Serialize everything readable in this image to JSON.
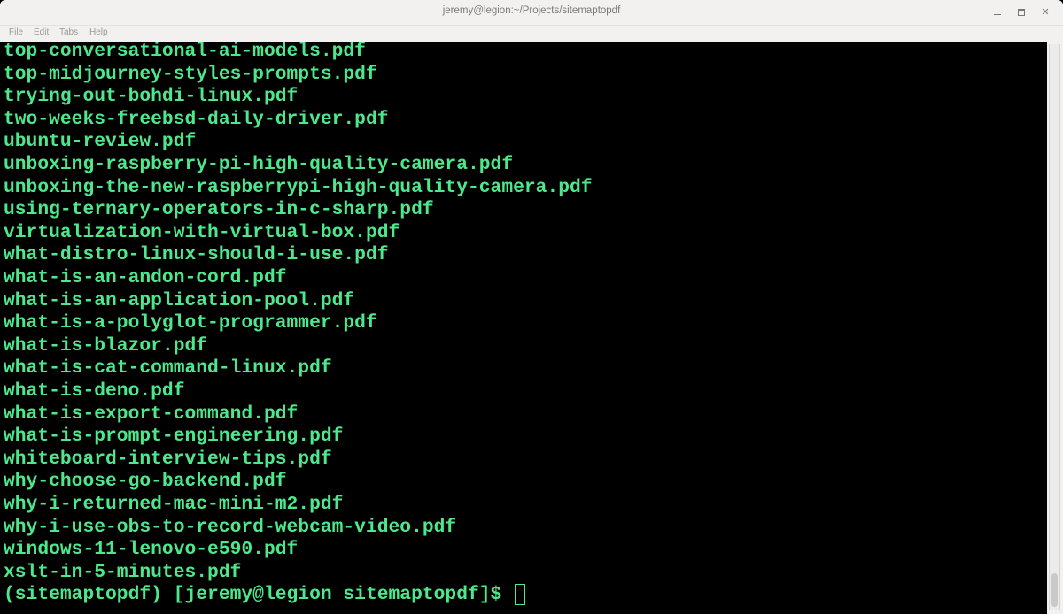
{
  "window": {
    "title": "jeremy@legion:~/Projects/sitemaptopdf",
    "controls": {
      "minimize": "minimize-icon",
      "maximize": "maximize-icon",
      "close": "close-icon",
      "close_glyph": "✕"
    }
  },
  "menubar": {
    "items": [
      "File",
      "Edit",
      "Tabs",
      "Help"
    ]
  },
  "terminal": {
    "text_color": "#4ee88c",
    "background": "#000000",
    "lines": [
      "top-conversational-ai-models.pdf",
      "top-midjourney-styles-prompts.pdf",
      "trying-out-bohdi-linux.pdf",
      "two-weeks-freebsd-daily-driver.pdf",
      "ubuntu-review.pdf",
      "unboxing-raspberry-pi-high-quality-camera.pdf",
      "unboxing-the-new-raspberrypi-high-quality-camera.pdf",
      "using-ternary-operators-in-c-sharp.pdf",
      "virtualization-with-virtual-box.pdf",
      "what-distro-linux-should-i-use.pdf",
      "what-is-an-andon-cord.pdf",
      "what-is-an-application-pool.pdf",
      "what-is-a-polyglot-programmer.pdf",
      "what-is-blazor.pdf",
      "what-is-cat-command-linux.pdf",
      "what-is-deno.pdf",
      "what-is-export-command.pdf",
      "what-is-prompt-engineering.pdf",
      "whiteboard-interview-tips.pdf",
      "why-choose-go-backend.pdf",
      "why-i-returned-mac-mini-m2.pdf",
      "why-i-use-obs-to-record-webcam-video.pdf",
      "windows-11-lenovo-e590.pdf",
      "xslt-in-5-minutes.pdf"
    ],
    "prompt": "(sitemaptopdf) [jeremy@legion sitemaptopdf]$ ",
    "input": ""
  },
  "scrollbar": {
    "position_fraction": 1.0
  }
}
